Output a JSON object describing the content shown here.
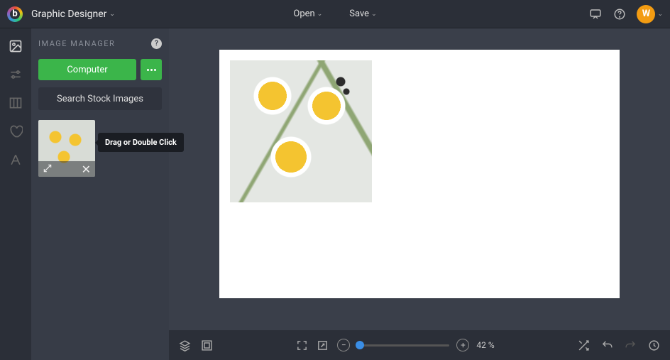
{
  "header": {
    "project_name": "Graphic Designer",
    "open_label": "Open",
    "save_label": "Save",
    "avatar_letter": "W"
  },
  "sidebar": {
    "title": "IMAGE MANAGER",
    "computer_label": "Computer",
    "search_stock_label": "Search Stock Images",
    "tooltip": "Drag or Double Click"
  },
  "bottombar": {
    "zoom_percent": "42 %"
  }
}
